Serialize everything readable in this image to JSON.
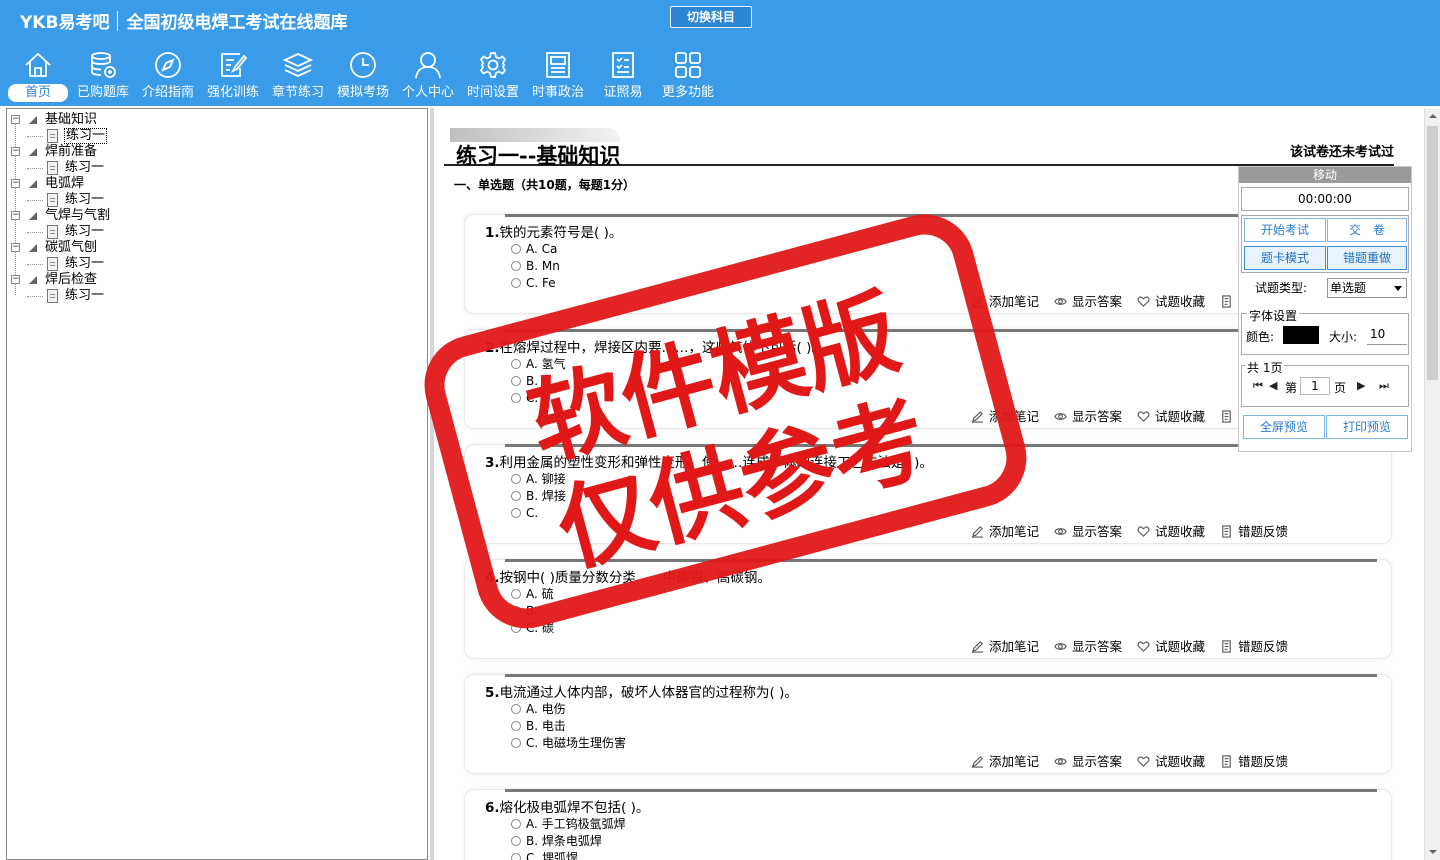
{
  "app": {
    "logo": "YKB易考吧",
    "title": "全国初级电焊工考试在线题库",
    "switch_subject": "切换科目"
  },
  "nav": [
    {
      "label": "首页",
      "icon": "home-icon",
      "active": true
    },
    {
      "label": "已购题库",
      "icon": "database-icon"
    },
    {
      "label": "介绍指南",
      "icon": "compass-icon"
    },
    {
      "label": "强化训练",
      "icon": "edit-icon"
    },
    {
      "label": "章节练习",
      "icon": "layers-icon"
    },
    {
      "label": "模拟考场",
      "icon": "clock-icon"
    },
    {
      "label": "个人中心",
      "icon": "user-icon"
    },
    {
      "label": "时间设置",
      "icon": "gear-icon"
    },
    {
      "label": "时事政治",
      "icon": "newspaper-icon"
    },
    {
      "label": "证照易",
      "icon": "checklist-icon"
    },
    {
      "label": "更多功能",
      "icon": "grid-icon"
    }
  ],
  "tree": [
    {
      "label": "基础知识",
      "child": "练习一",
      "selected": true
    },
    {
      "label": "焊前准备",
      "child": "练习一"
    },
    {
      "label": "电弧焊",
      "child": "练习一"
    },
    {
      "label": "气焊与气割",
      "child": "练习一"
    },
    {
      "label": "碳弧气刨",
      "child": "练习一"
    },
    {
      "label": "焊后检查",
      "child": "练习一"
    }
  ],
  "paper": {
    "title": "练习一--基础知识",
    "status": "该试卷还未考试过",
    "section": "一、单选题（共10题，每题1分）"
  },
  "actions": {
    "note": "添加笔记",
    "answer": "显示答案",
    "favorite": "试题收藏",
    "feedback": "错题反馈"
  },
  "questions": [
    {
      "num": "1.",
      "stem": "铁的元素符号是( )。",
      "options": [
        "A. Ca",
        "B. Mn",
        "C. Fe"
      ]
    },
    {
      "num": "2.",
      "stem": "在熔焊过程中，焊接区内要……，这些气体不包括( )。",
      "options": [
        "A. 氢气",
        "B. ",
        "C. "
      ]
    },
    {
      "num": "3.",
      "stem": "利用金属的塑性变形和弹性变形，使……连成一体的连接工艺方法是( )。",
      "options": [
        "A. 铆接",
        "B. 焊接",
        "C. "
      ]
    },
    {
      "num": "4.",
      "stem": "按钢中(  )质量分数分类……中碳钢、高碳钢。",
      "options": [
        "A. 硫",
        "B. ",
        "C. 碳"
      ]
    },
    {
      "num": "5.",
      "stem": "电流通过人体内部，破坏人体器官的过程称为( )。",
      "options": [
        "A. 电伤",
        "B. 电击",
        "C. 电磁场生理伤害"
      ]
    },
    {
      "num": "6.",
      "stem": "熔化极电弧焊不包括( )。",
      "options": [
        "A. 手工钨极氩弧焊",
        "B. 焊条电弧焊",
        "C. 埋弧焊"
      ]
    }
  ],
  "panel": {
    "move": "移动",
    "timer": "00:00:00",
    "start": "开始考试",
    "submit": "交　卷",
    "card_mode": "题卡模式",
    "redo_wrong": "错题重做",
    "type_label": "试题类型:",
    "type_value": "单选题",
    "font_settings": "字体设置",
    "color_label": "颜色:",
    "color_value": "#000000",
    "size_label": "大小:",
    "size_value": "10",
    "total_pages": "共 1页",
    "page_prefix": "第",
    "page_value": "1",
    "page_suffix": "页",
    "fullscreen": "全屏预览",
    "print": "打印预览"
  },
  "watermark": {
    "line1": "软件模版",
    "line2": "仅供参考",
    "color": "#e01818"
  }
}
